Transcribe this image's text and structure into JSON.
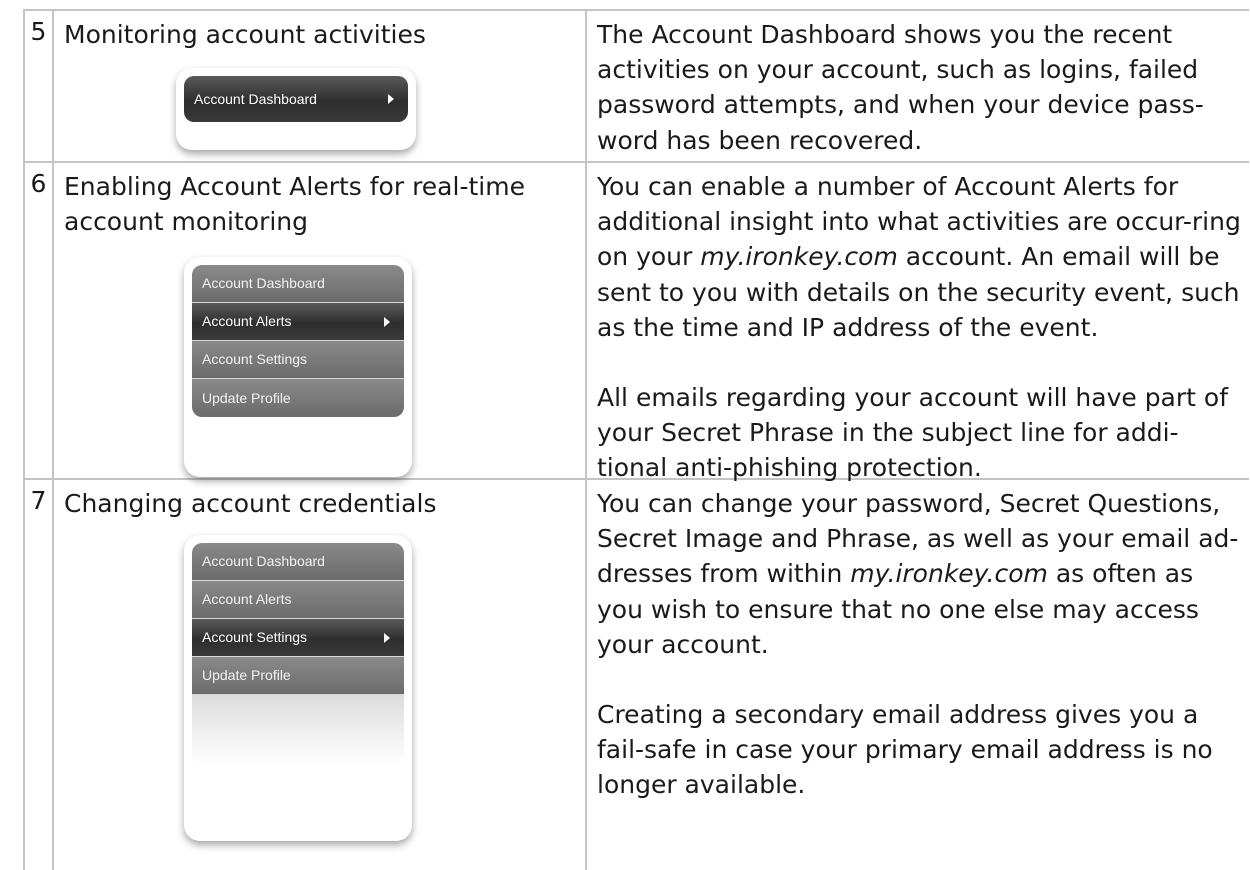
{
  "rows": [
    {
      "number": "5",
      "task": "Monitoring account activities",
      "menu": [
        {
          "label": "Account Dashboard",
          "active": true
        }
      ],
      "description": [
        "The Account Dashboard shows you the recent activities on your account, such as logins, failed password attempts, and when your device pass-word has been recovered."
      ]
    },
    {
      "number": "6",
      "task": "Enabling Account Alerts for real-time account monitoring",
      "menu": [
        {
          "label": "Account Dashboard",
          "active": false
        },
        {
          "label": "Account Alerts",
          "active": true
        },
        {
          "label": "Account Settings",
          "active": false
        },
        {
          "label": "Update Profile",
          "active": false
        }
      ],
      "description_parts": {
        "p1_a": "You can enable a number of Account Alerts for additional insight into what activities are occur-ring on your ",
        "p1_em": "my.ironkey.com",
        "p1_b": " account.  An email will be sent to you with details on the security event, such as the time and IP address of the event.",
        "p2": "All emails regarding your account will have part of your Secret Phrase in the subject line for addi-tional anti-phishing protection."
      }
    },
    {
      "number": "7",
      "task": "Changing account credentials",
      "menu": [
        {
          "label": "Account Dashboard",
          "active": false
        },
        {
          "label": "Account Alerts",
          "active": false
        },
        {
          "label": "Account Settings",
          "active": true
        },
        {
          "label": "Update Profile",
          "active": false
        }
      ],
      "description_parts": {
        "p1_a": "You can change your password, Secret Questions, Secret Image and Phrase, as well as your email ad-dresses from within ",
        "p1_em": "my.ironkey.com",
        "p1_b": " as often as you wish to ensure that no one else may access your account.",
        "p2": "Creating a secondary email address gives you a fail-safe in case your primary email address is no longer available."
      }
    }
  ]
}
